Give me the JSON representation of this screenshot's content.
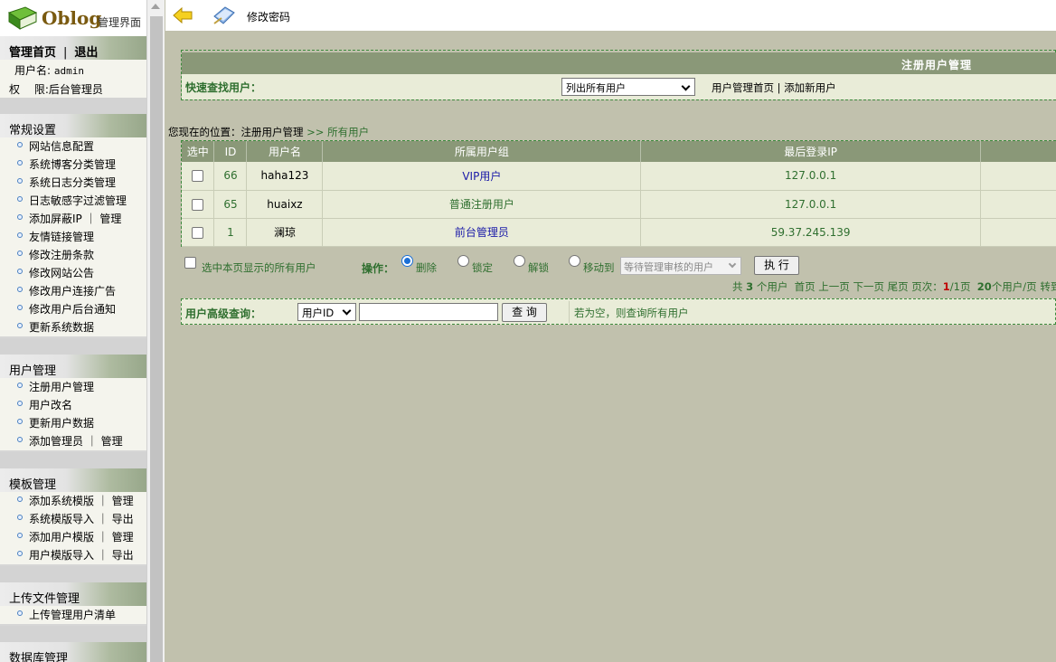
{
  "logo": {
    "brand": "Oblog",
    "subtitle": "管理界面"
  },
  "header_nav": {
    "home": "管理首页",
    "separator": "|",
    "logout": "退出"
  },
  "user_info": {
    "username_label": "用户名:",
    "username": "admin",
    "role_label": "权　 限:",
    "role": "后台管理员"
  },
  "sidebar": {
    "sections": [
      {
        "title": "常规设置",
        "items": [
          "网站信息配置",
          "系统博客分类管理",
          "系统日志分类管理",
          "日志敏感字过滤管理",
          "添加屏蔽IP ｜ 管理",
          "友情链接管理",
          "修改注册条款",
          "修改网站公告",
          "修改用户连接广告",
          "修改用户后台通知",
          "更新系统数据"
        ]
      },
      {
        "title": "用户管理",
        "items": [
          "注册用户管理",
          "用户改名",
          "更新用户数据",
          "添加管理员 ｜ 管理"
        ]
      },
      {
        "title": "模板管理",
        "items": [
          "添加系统模版 ｜ 管理",
          "系统模版导入 ｜ 导出",
          "添加用户模版 ｜ 管理",
          "用户模版导入 ｜ 导出"
        ]
      },
      {
        "title": "上传文件管理",
        "items": [
          "上传管理用户清单"
        ]
      },
      {
        "title": "数据库管理",
        "items": []
      }
    ]
  },
  "topbar": {
    "change_password": "修改密码"
  },
  "quick_find": {
    "panel_title": "注册用户管理",
    "label": "快速查找用户：",
    "select_value": "列出所有用户",
    "link_home": "用户管理首页",
    "link_sep": " | ",
    "link_add": "添加新用户"
  },
  "breadcrumb": {
    "prefix": "您现在的位置：",
    "current": "注册用户管理",
    "sep": " >> ",
    "page": "所有用户"
  },
  "table": {
    "headers": [
      "选中",
      "ID",
      "用户名",
      "所属用户组",
      "最后登录IP",
      ""
    ],
    "rows": [
      {
        "id": "66",
        "name": "haha123",
        "group": "VIP用户",
        "ip": "127.0.0.1"
      },
      {
        "id": "65",
        "name": "huaixz",
        "group": "普通注册用户",
        "ip": "127.0.0.1"
      },
      {
        "id": "1",
        "name": "澜琼",
        "group": "前台管理员",
        "ip": "59.37.245.139"
      }
    ]
  },
  "operations": {
    "select_all": "选中本页显示的所有用户",
    "label": "操作：",
    "options": [
      "删除",
      "锁定",
      "解锁",
      "移动到"
    ],
    "selected_option": "删除",
    "move_target": "等待管理审核的用户",
    "execute": "执 行"
  },
  "pager": {
    "total_prefix": "共 ",
    "total": "3",
    "total_suffix": " 个用户",
    "first": "首页",
    "prev": "上一页",
    "next": "下一页",
    "last": "尾页",
    "page_label": "页次：",
    "current_page": "1",
    "page_total": "/1页",
    "per_page": "20",
    "per_page_suffix": "个用户/页",
    "goto": "转到"
  },
  "advanced_search": {
    "label": "用户高级查询：",
    "field": "用户ID",
    "input_value": "",
    "query_button": "查 询",
    "hint": "若为空，则查询所有用户"
  },
  "colors": {
    "header_bg": "#8a9878",
    "row_bg": "#e9ecd8",
    "page_bg": "#c1c1ad",
    "label_green": "#2f6f2f",
    "link_blue": "#1a1aa8",
    "radio_blue": "#1a6fd6"
  }
}
